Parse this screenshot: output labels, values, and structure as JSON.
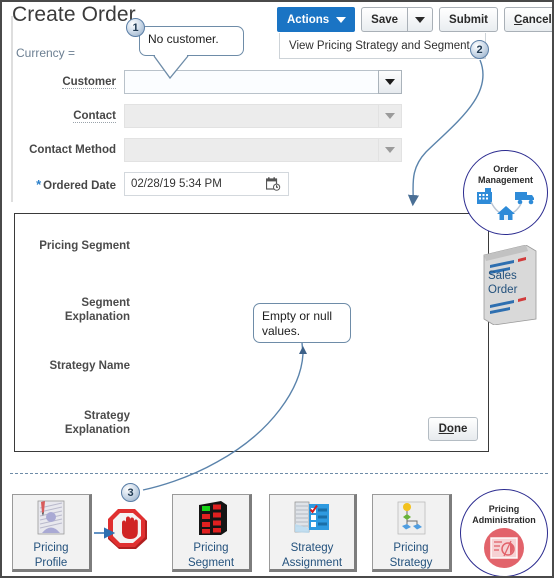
{
  "page": {
    "title": "Create Order",
    "currency_label": "Currency ="
  },
  "toolbar": {
    "actions_label": "Actions",
    "save_label": "Save",
    "submit_label": "Submit",
    "cancel_label": "Cancel",
    "cancel_accel": "C",
    "cancel_rest": "ancel"
  },
  "tab": {
    "label": "View Pricing Strategy and Segment"
  },
  "form": {
    "fields": [
      {
        "label": "Customer",
        "value": "",
        "state": "enabled",
        "control": "dropdown"
      },
      {
        "label": "Contact",
        "value": "",
        "state": "disabled",
        "control": "dropdown"
      },
      {
        "label": "Contact Method",
        "value": "",
        "state": "disabled",
        "control": "dropdown"
      },
      {
        "label": "Ordered Date",
        "value": "02/28/19 5:34 PM",
        "state": "plain",
        "control": "date",
        "required": true
      }
    ]
  },
  "pricing_panel": {
    "rows": [
      {
        "label": "Pricing Segment",
        "value": ""
      },
      {
        "label": "Segment\nExplanation",
        "value": ""
      },
      {
        "label": "Strategy Name",
        "value": ""
      },
      {
        "label": "Strategy\nExplanation",
        "value": ""
      }
    ],
    "done_label": "Done",
    "done_accel": "D",
    "done_mid": "o",
    "done_rest": "ne"
  },
  "callouts": [
    {
      "number": "1",
      "text": "No customer."
    },
    {
      "number": "2",
      "text": ""
    },
    {
      "number": "3",
      "text": ""
    }
  ],
  "bubbles": {
    "no_customer": "No customer.",
    "empty_or_null": "Empty or null values."
  },
  "nodes": {
    "order_management": "Order\nManagement",
    "sales_order": "Sales\nOrder",
    "pricing_administration": "Pricing\nAdministration"
  },
  "tiles": [
    {
      "label": "Pricing\nProfile",
      "icon": "pricing-profile-icon"
    },
    {
      "label": "Pricing\nSegment",
      "icon": "pricing-segment-icon"
    },
    {
      "label": "Strategy\nAssignment",
      "icon": "strategy-assignment-icon"
    },
    {
      "label": "Pricing\nStrategy",
      "icon": "pricing-strategy-icon"
    }
  ],
  "icons": {
    "stop": "stop-hand-icon",
    "calendar": "calendar-clock-icon",
    "caret": "chevron-down-icon"
  },
  "colors": {
    "primary_button": "#1a74c4",
    "link_text": "#24527d",
    "callout_stroke": "#6e8ca8",
    "circle_stroke": "#2b2b8f",
    "currency_text": "#6c7f92",
    "required_star": "#2a7fc9"
  }
}
